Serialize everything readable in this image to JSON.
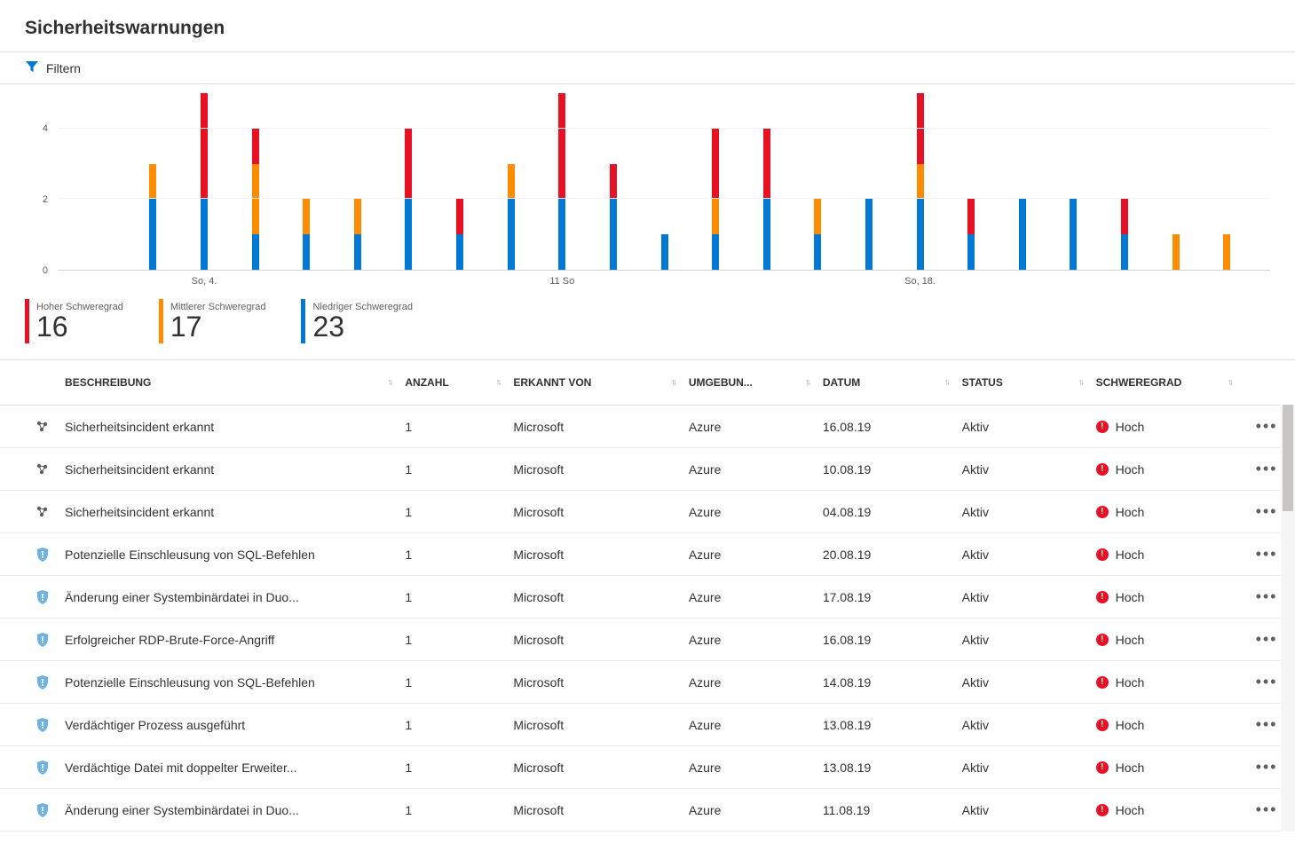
{
  "page": {
    "title": "Sicherheitswarnungen"
  },
  "filter": {
    "label": "Filtern"
  },
  "chart_data": {
    "type": "bar",
    "ylabel": "",
    "xlabel": "",
    "ylim": [
      0,
      5
    ],
    "yticks": [
      0,
      2,
      4
    ],
    "categories": [
      "",
      "",
      "So, 4.",
      "",
      "",
      "",
      "",
      "",
      "",
      "11 So",
      "",
      "",
      "",
      "",
      "",
      "",
      "So, 18.",
      "",
      "",
      "",
      ""
    ],
    "series": [
      {
        "name": "Hoher Schweregrad",
        "color": "#e81123",
        "values": [
          0,
          0,
          3,
          1,
          0,
          0,
          2,
          1,
          0,
          3,
          1,
          0,
          2,
          2,
          0,
          0,
          2,
          1,
          0,
          0,
          1,
          0,
          0
        ]
      },
      {
        "name": "Mittlerer Schweregrad",
        "color": "#ff8c00",
        "values": [
          0,
          1,
          0,
          2,
          1,
          1,
          0,
          0,
          1,
          0,
          0,
          0,
          1,
          0,
          1,
          0,
          1,
          0,
          0,
          0,
          0,
          1,
          1
        ]
      },
      {
        "name": "Niedriger Schweregrad",
        "color": "#0078d4",
        "values": [
          0,
          2,
          2,
          1,
          1,
          1,
          2,
          1,
          2,
          2,
          2,
          1,
          1,
          2,
          1,
          2,
          2,
          1,
          2,
          2,
          1,
          0,
          0
        ]
      }
    ],
    "x_major_ticks": [
      {
        "index": 2,
        "label": "So, 4."
      },
      {
        "index": 9,
        "label": "11 So"
      },
      {
        "index": 16,
        "label": "So, 18."
      }
    ]
  },
  "summary": {
    "high": {
      "label": "Hoher Schweregrad",
      "count": "16",
      "color": "#e81123"
    },
    "medium": {
      "label": "Mittlerer Schweregrad",
      "count": "17",
      "color": "#ff8c00"
    },
    "low": {
      "label": "Niedriger Schweregrad",
      "count": "23",
      "color": "#0078d4"
    }
  },
  "table": {
    "columns": {
      "description": "Beschreibung",
      "count": "Anzahl",
      "detected_by": "Erkannt von",
      "environment": "Umgebun...",
      "date": "Datum",
      "status": "Status",
      "severity": "Schweregrad"
    },
    "severity_labels": {
      "high": "Hoch"
    },
    "rows": [
      {
        "icon": "incident",
        "description": "Sicherheitsincident erkannt",
        "count": "1",
        "detected_by": "Microsoft",
        "environment": "Azure",
        "date": "16.08.19",
        "status": "Aktiv",
        "severity": "high"
      },
      {
        "icon": "incident",
        "description": "Sicherheitsincident erkannt",
        "count": "1",
        "detected_by": "Microsoft",
        "environment": "Azure",
        "date": "10.08.19",
        "status": "Aktiv",
        "severity": "high"
      },
      {
        "icon": "incident",
        "description": "Sicherheitsincident erkannt",
        "count": "1",
        "detected_by": "Microsoft",
        "environment": "Azure",
        "date": "04.08.19",
        "status": "Aktiv",
        "severity": "high"
      },
      {
        "icon": "shield",
        "description": "Potenzielle Einschleusung von SQL-Befehlen",
        "count": "1",
        "detected_by": "Microsoft",
        "environment": "Azure",
        "date": "20.08.19",
        "status": "Aktiv",
        "severity": "high"
      },
      {
        "icon": "shield",
        "description": "Änderung einer Systembinärdatei in Duo...",
        "count": "1",
        "detected_by": "Microsoft",
        "environment": "Azure",
        "date": "17.08.19",
        "status": "Aktiv",
        "severity": "high"
      },
      {
        "icon": "shield",
        "description": "Erfolgreicher RDP-Brute-Force-Angriff",
        "count": "1",
        "detected_by": "Microsoft",
        "environment": "Azure",
        "date": "16.08.19",
        "status": "Aktiv",
        "severity": "high"
      },
      {
        "icon": "shield",
        "description": "Potenzielle Einschleusung von SQL-Befehlen",
        "count": "1",
        "detected_by": "Microsoft",
        "environment": "Azure",
        "date": "14.08.19",
        "status": "Aktiv",
        "severity": "high"
      },
      {
        "icon": "shield",
        "description": "Verdächtiger Prozess ausgeführt",
        "count": "1",
        "detected_by": "Microsoft",
        "environment": "Azure",
        "date": "13.08.19",
        "status": "Aktiv",
        "severity": "high"
      },
      {
        "icon": "shield",
        "description": "Verdächtige Datei mit doppelter Erweiter...",
        "count": "1",
        "detected_by": "Microsoft",
        "environment": "Azure",
        "date": "13.08.19",
        "status": "Aktiv",
        "severity": "high"
      },
      {
        "icon": "shield",
        "description": "Änderung einer Systembinärdatei in Duo...",
        "count": "1",
        "detected_by": "Microsoft",
        "environment": "Azure",
        "date": "11.08.19",
        "status": "Aktiv",
        "severity": "high"
      }
    ]
  },
  "icons": {
    "more": "…"
  }
}
